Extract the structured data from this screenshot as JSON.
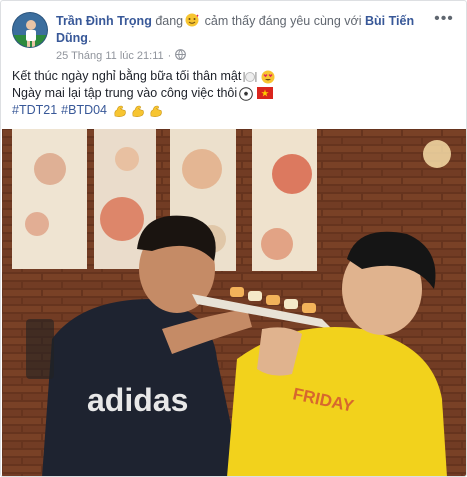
{
  "post": {
    "author": "Trần Đình Trọng",
    "feeling_prefix": "đang",
    "feeling_text": "cảm thấy đáng yêu cùng với",
    "tagged_user": "Bùi Tiến Dũng",
    "tagged_suffix": ".",
    "timestamp": "25 Tháng 11 lúc 21:11",
    "privacy_icon": "globe-icon",
    "feeling_icon": "smiling-face-with-hearts-icon",
    "line1": "Kết thúc ngày nghỉ bằng bữa tối thân mật",
    "line1_icons": [
      "fork-and-knife-with-plate-icon",
      "heart-eyes-icon"
    ],
    "line2": "Ngày mai lại tập trung vào công việc thôi",
    "line2_icons": [
      "soccer-ball-icon",
      "vietnam-flag-icon"
    ],
    "hashtags": [
      "#TDT21",
      "#BTD04"
    ],
    "hashtag_icons": [
      "flexed-biceps-icon",
      "flexed-biceps-icon",
      "flexed-biceps-icon"
    ],
    "photo_shirt_text_left": "adidas",
    "photo_shirt_text_right": "FRIDAY"
  },
  "colors": {
    "link": "#385898",
    "text": "#1d2129",
    "meta": "#90949c",
    "border": "#dddfe2",
    "yellow_shirt": "#f2d21c",
    "brick": "#8a4a2c"
  }
}
